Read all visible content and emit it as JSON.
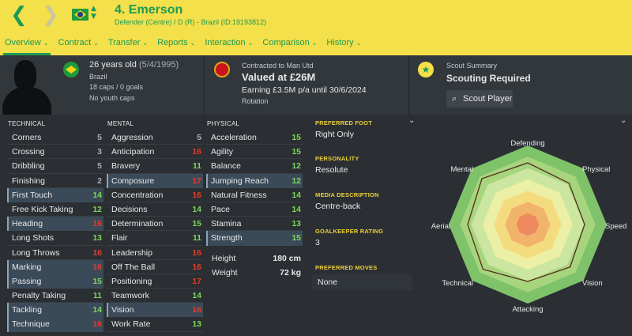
{
  "header": {
    "name": "4. Emerson",
    "subtitle": "Defender (Centre) / D (R) - Brazil (ID:19193812)",
    "back_glyph": "❮",
    "forward_glyph": "❯",
    "tabs": [
      "Overview",
      "Contract",
      "Transfer",
      "Reports",
      "Interaction",
      "Comparison",
      "History"
    ]
  },
  "profile": {
    "age": "26 years old",
    "dob": "(5/4/1995)",
    "nation": "Brazil",
    "caps": "18 caps / 0 goals",
    "youth": "No youth caps"
  },
  "contract": {
    "heading": "Contracted to Man Utd",
    "value": "Valued at £26M",
    "earning": "Earning £3.5M p/a until 30/6/2024",
    "status": "Rotation"
  },
  "scout": {
    "heading": "Scout Summary",
    "status": "Scouting Required",
    "button": "Scout Player",
    "icon_glyph": "★",
    "button_icon_glyph": "⌕"
  },
  "attributes": {
    "technical": {
      "title": "TECHNICAL",
      "rows": [
        {
          "label": "Corners",
          "value": "5"
        },
        {
          "label": "Crossing",
          "value": "3"
        },
        {
          "label": "Dribbling",
          "value": "5"
        },
        {
          "label": "Finishing",
          "value": "2"
        },
        {
          "label": "First Touch",
          "value": "14"
        },
        {
          "label": "Free Kick Taking",
          "value": "12"
        },
        {
          "label": "Heading",
          "value": "16"
        },
        {
          "label": "Long Shots",
          "value": "13"
        },
        {
          "label": "Long Throws",
          "value": "16"
        },
        {
          "label": "Marking",
          "value": "16"
        },
        {
          "label": "Passing",
          "value": "15"
        },
        {
          "label": "Penalty Taking",
          "value": "11"
        },
        {
          "label": "Tackling",
          "value": "14"
        },
        {
          "label": "Technique",
          "value": "16"
        }
      ]
    },
    "mental": {
      "title": "MENTAL",
      "rows": [
        {
          "label": "Aggression",
          "value": "5"
        },
        {
          "label": "Anticipation",
          "value": "16"
        },
        {
          "label": "Bravery",
          "value": "11"
        },
        {
          "label": "Composure",
          "value": "17"
        },
        {
          "label": "Concentration",
          "value": "16"
        },
        {
          "label": "Decisions",
          "value": "14"
        },
        {
          "label": "Determination",
          "value": "15"
        },
        {
          "label": "Flair",
          "value": "11"
        },
        {
          "label": "Leadership",
          "value": "16"
        },
        {
          "label": "Off The Ball",
          "value": "16"
        },
        {
          "label": "Positioning",
          "value": "17"
        },
        {
          "label": "Teamwork",
          "value": "14"
        },
        {
          "label": "Vision",
          "value": "16"
        },
        {
          "label": "Work Rate",
          "value": "13"
        }
      ]
    },
    "physical": {
      "title": "PHYSICAL",
      "rows": [
        {
          "label": "Acceleration",
          "value": "15"
        },
        {
          "label": "Agility",
          "value": "15"
        },
        {
          "label": "Balance",
          "value": "12"
        },
        {
          "label": "Jumping Reach",
          "value": "12"
        },
        {
          "label": "Natural Fitness",
          "value": "14"
        },
        {
          "label": "Pace",
          "value": "14"
        },
        {
          "label": "Stamina",
          "value": "13"
        },
        {
          "label": "Strength",
          "value": "15"
        }
      ],
      "height_label": "Height",
      "height": "180 cm",
      "weight_label": "Weight",
      "weight": "72 kg"
    }
  },
  "details": {
    "foot_title": "PREFERRED FOOT",
    "foot": "Right Only",
    "personality_title": "PERSONALITY",
    "personality": "Resolute",
    "media_title": "MEDIA DESCRIPTION",
    "media": "Centre-back",
    "gk_title": "GOALKEEPER RATING",
    "gk": "3",
    "moves_title": "PREFERRED MOVES",
    "moves": "None"
  },
  "radar": {
    "axes": [
      "Defending",
      "Physical",
      "Speed",
      "Vision",
      "Attacking",
      "Technical",
      "Aerial",
      "Mental"
    ],
    "ring_colors": [
      "#7ec26a",
      "#a6d57e",
      "#cbe6a0",
      "#ecf0a6",
      "#f4db7e",
      "#f2b36b",
      "#ef8a5f"
    ],
    "player_values": [
      0.78,
      0.74,
      0.72,
      0.76,
      0.72,
      0.8,
      0.76,
      0.82
    ],
    "line_color": "#5a2a1f"
  },
  "colors": {
    "header_bg": "#f3e04a",
    "accent_green": "#1e9a56",
    "good": "#7bd65a",
    "bad": "#e23b2c",
    "detail_title": "#e9cf3b"
  }
}
